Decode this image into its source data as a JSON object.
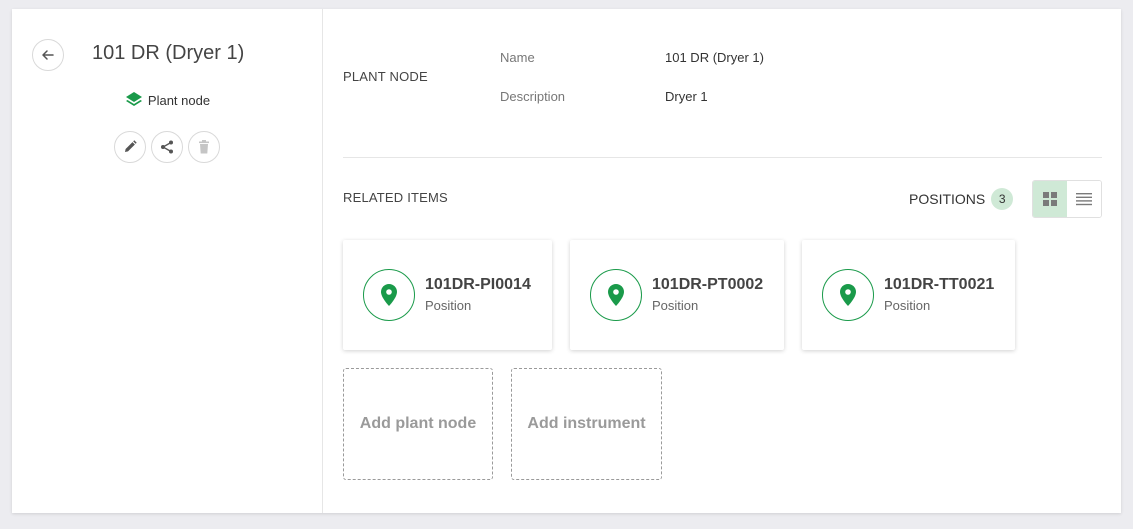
{
  "node": {
    "title": "101 DR (Dryer 1)",
    "type_label": "Plant node"
  },
  "details": {
    "section_label": "PLANT NODE",
    "name_key": "Name",
    "name_value": "101 DR (Dryer 1)",
    "description_key": "Description",
    "description_value": "Dryer 1"
  },
  "related": {
    "section_label": "RELATED ITEMS",
    "positions_label": "POSITIONS",
    "positions_count": "3",
    "items": [
      {
        "name": "101DR-PI0014",
        "type": "Position"
      },
      {
        "name": "101DR-PT0002",
        "type": "Position"
      },
      {
        "name": "101DR-TT0021",
        "type": "Position"
      }
    ],
    "add_plant_node_label": "Add plant node",
    "add_instrument_label": "Add instrument"
  },
  "colors": {
    "accent": "#1a9a4a",
    "badge_bg": "#cfe9d6"
  },
  "icons": {
    "back": "arrow-left-icon",
    "type": "layers-icon",
    "edit": "pencil-icon",
    "share": "share-icon",
    "delete": "trash-icon",
    "position": "map-pin-icon",
    "grid_view": "grid-icon",
    "list_view": "list-icon"
  }
}
